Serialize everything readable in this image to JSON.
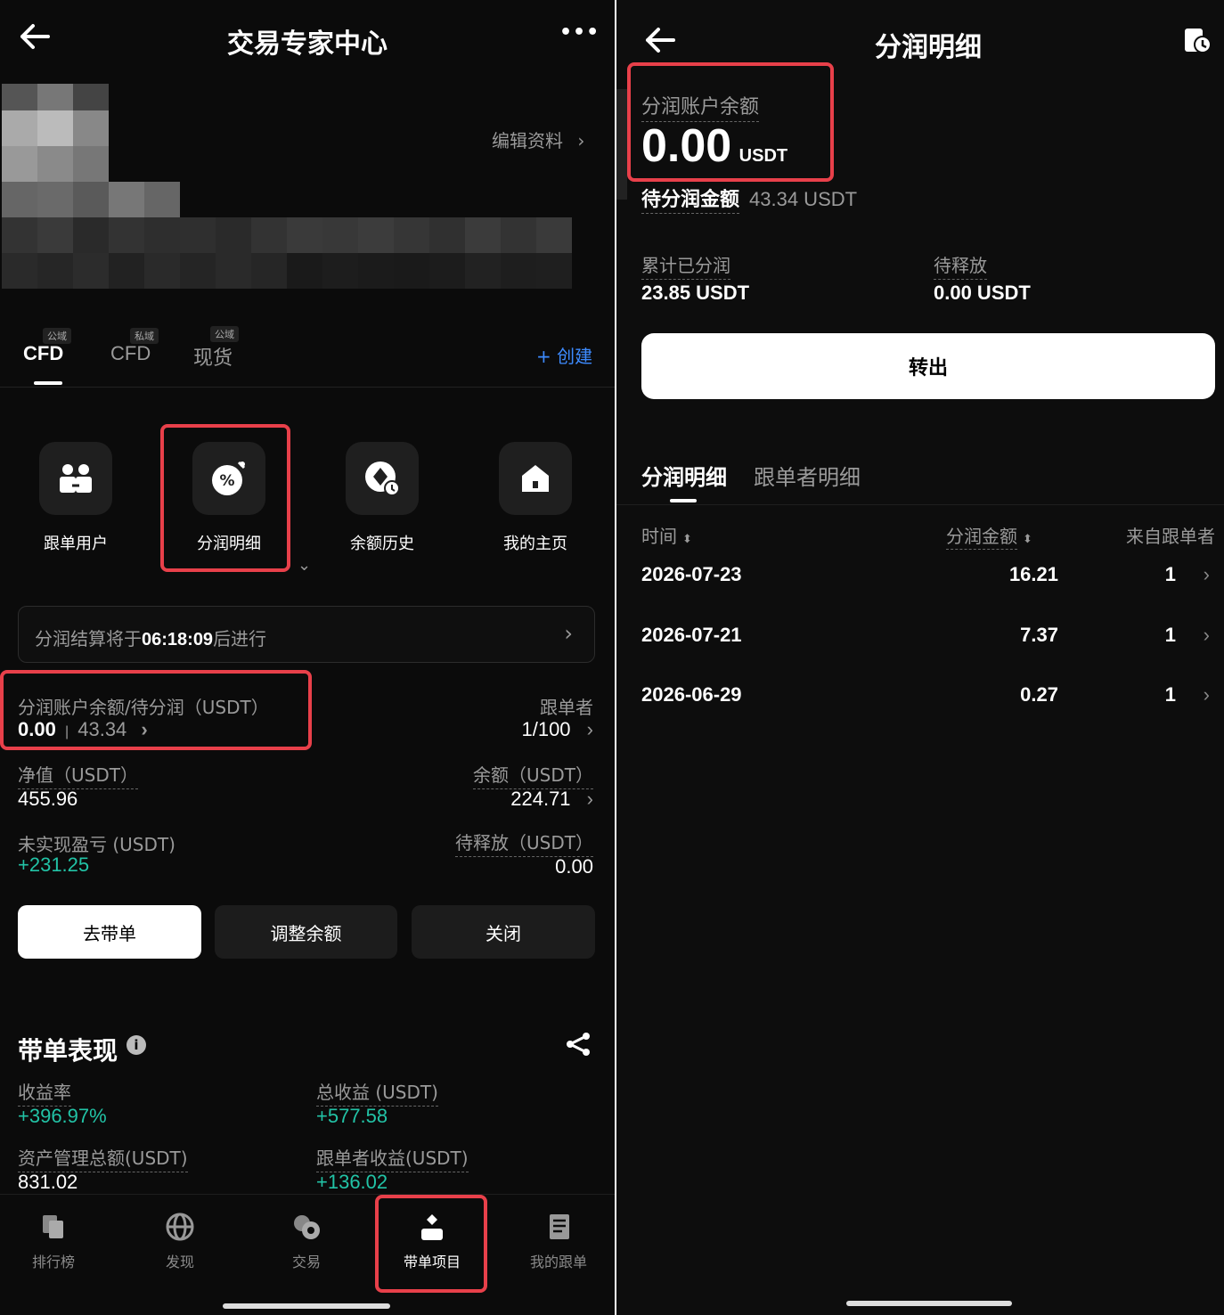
{
  "left": {
    "header": {
      "title": "交易专家中心",
      "more": "•••"
    },
    "profile": {
      "edit_label": "编辑资料"
    },
    "tabs": [
      {
        "tag": "公域",
        "label": "CFD"
      },
      {
        "tag": "私域",
        "label": "CFD"
      },
      {
        "tag": "公域",
        "label": "现货"
      }
    ],
    "create_label": "+ 创建",
    "shortcuts": [
      {
        "label": "跟单用户",
        "icon": "users-icon"
      },
      {
        "label": "分润明细",
        "icon": "percent-icon"
      },
      {
        "label": "余额历史",
        "icon": "history-icon"
      },
      {
        "label": "我的主页",
        "icon": "home-icon"
      }
    ],
    "settlement": {
      "prefix": "分润结算将于",
      "time": "06:18:09",
      "suffix": "后进行"
    },
    "stats": {
      "balance_label": "分润账户余额/待分润（USDT）",
      "balance_value": "0.00",
      "pending_value": "43.34",
      "followers_label": "跟单者",
      "followers_value": "1/100",
      "net_label": "净值（USDT）",
      "net_value": "455.96",
      "remaining_label": "余额（USDT）",
      "remaining_value": "224.71",
      "unrealized_label": "未实现盈亏 (USDT)",
      "unrealized_value": "+231.25",
      "to_release_label": "待释放（USDT）",
      "to_release_value": "0.00"
    },
    "actions": {
      "go_copy": "去带单",
      "adjust": "调整余额",
      "close": "关闭"
    },
    "performance": {
      "title": "带单表现",
      "yield_label": "收益率",
      "yield_value": "+396.97%",
      "total_label": "总收益 (USDT)",
      "total_value": "+577.58",
      "aum_label": "资产管理总额(USDT)",
      "aum_value": "831.02",
      "follower_profit_label": "跟单者收益(USDT)",
      "follower_profit_value": "+136.02"
    },
    "bottom_nav": [
      {
        "label": "排行榜",
        "icon": "ranking-icon"
      },
      {
        "label": "发现",
        "icon": "globe-icon"
      },
      {
        "label": "交易",
        "icon": "trade-icon"
      },
      {
        "label": "带单项目",
        "icon": "lead-trader-icon"
      },
      {
        "label": "我的跟单",
        "icon": "document-icon"
      }
    ]
  },
  "right": {
    "header": {
      "title": "分润明细"
    },
    "balance_label": "分润账户余额",
    "balance_value": "0.00",
    "balance_unit": "USDT",
    "pending_label": "待分润金额",
    "pending_value": "43.34 USDT",
    "cumulative_label": "累计已分润",
    "cumulative_value": "23.85 USDT",
    "to_release_label": "待释放",
    "to_release_value": "0.00 USDT",
    "transfer_label": "转出",
    "tabs": [
      "分润明细",
      "跟单者明细"
    ],
    "table": {
      "headers": [
        "时间",
        "分润金额",
        "来自跟单者"
      ],
      "rows": [
        {
          "date": "2026-07-23",
          "amount": "16.21",
          "from": "1"
        },
        {
          "date": "2026-07-21",
          "amount": "7.37",
          "from": "1"
        },
        {
          "date": "2026-06-29",
          "amount": "0.27",
          "from": "1"
        }
      ]
    }
  },
  "colors": {
    "accent_green": "#22c3a6",
    "highlight_red": "#e8404a",
    "link_blue": "#3d8bff"
  }
}
